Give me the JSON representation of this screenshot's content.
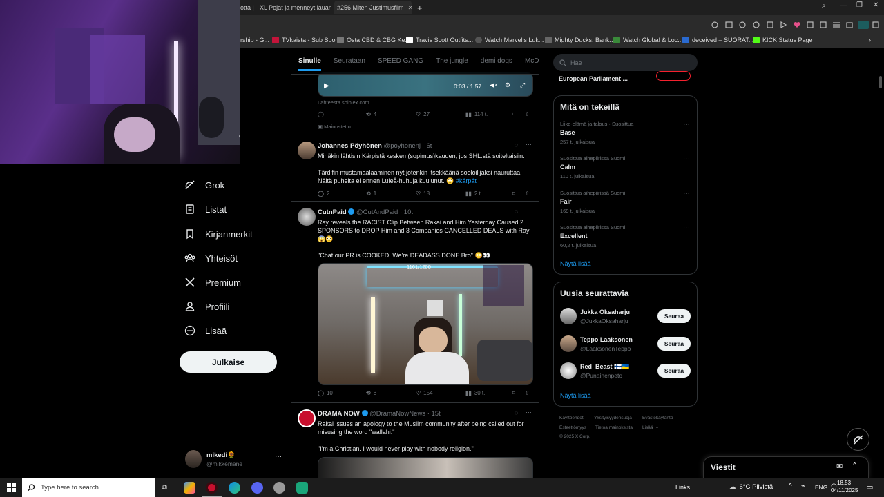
{
  "browser": {
    "tabs": [
      {
        "label": "otta |"
      },
      {
        "label": "XL Pojat ja menneyt lauant"
      },
      {
        "label": "#256 Miten Justimusfilm"
      }
    ],
    "new_tab": "+",
    "bookmarks": [
      {
        "label": "rship - G..."
      },
      {
        "label": "TVkaista - Sub Suora"
      },
      {
        "label": "Osta CBD & CBG Ke..."
      },
      {
        "label": "Travis Scott Outfits..."
      },
      {
        "label": "Watch Marvel's Luk..."
      },
      {
        "label": "Mighty Ducks: Bank..."
      },
      {
        "label": "Watch Global & Loc..."
      },
      {
        "label": "deceived – SUORAT..."
      },
      {
        "label": "KICK Status Page"
      }
    ]
  },
  "webcam": {
    "partial_text": "et"
  },
  "sidebar": {
    "items": [
      {
        "label": "Grok",
        "icon": "grok-icon"
      },
      {
        "label": "Listat",
        "icon": "list-icon"
      },
      {
        "label": "Kirjanmerkit",
        "icon": "bookmark-icon"
      },
      {
        "label": "Yhteisöt",
        "icon": "communities-icon"
      },
      {
        "label": "Premium",
        "icon": "x-logo-icon"
      },
      {
        "label": "Profiili",
        "icon": "profile-icon"
      },
      {
        "label": "Lisää",
        "icon": "more-circle-icon"
      }
    ],
    "post_button": "Julkaise",
    "account": {
      "name": "mikedi🌻",
      "handle": "@mikkemane",
      "more": "···"
    }
  },
  "feed": {
    "tabs": [
      {
        "label": "Sinulle",
        "active": true
      },
      {
        "label": "Seurataan"
      },
      {
        "label": "SPEED GANG"
      },
      {
        "label": "The jungle"
      },
      {
        "label": "demi dogs"
      },
      {
        "label": "McDonal"
      }
    ],
    "ad": {
      "video_time": "0:03 / 1:57",
      "source": "Lähteestä solplex.com",
      "retweets": "4",
      "likes": "27",
      "views": "114 t.",
      "promoted": "Mainostettu"
    },
    "tweets": [
      {
        "name": "Johannes Pöyhönen",
        "handle": "@poyhonenj",
        "time": "· 6t",
        "text1": "Minäkin lähtisin Kärpistä kesken (sopimus)kauden, jos SHL:stä soiteltaisiin.",
        "text2": "Tärdifin mustamaalaaminen nyt jotenkin itsekkäänä sooloilijaksi nauruttaa. Näitä puheita ei ennen Luleå-huhuja kuulunut. 🙄",
        "hashtag": "#kärpät",
        "replies": "2",
        "retweets": "1",
        "likes": "18",
        "views": "2 t."
      },
      {
        "name": "CutnPaid",
        "handle": "@CutAndPaid",
        "time": "· 10t",
        "text1": "Ray reveals the RACIST Clip Between Rakai and Him Yesterday Caused 2 SPONSORS to DROP Him and 3 Companies CANCELLED DEALS with Ray 😱😳",
        "text2": "\"Chat our PR is COOKED. We're DEADASS DONE Bro\" 😳👀",
        "media_counter": "1161/1200",
        "replies": "10",
        "retweets": "8",
        "likes": "154",
        "views": "30 t."
      },
      {
        "name": "DRAMA NOW",
        "handle": "@DramaNowNews",
        "time": "· 15t",
        "text1": "Rakai issues an apology to the Muslim community after being called out for misusing the word \"wallahi.\"",
        "text2": "\"I'm a Christian. I would never play with nobody religion.\""
      }
    ]
  },
  "right": {
    "search_placeholder": "Hae",
    "top_partial": "European Parliament ...",
    "trends_title": "Mitä on tekeillä",
    "trends": [
      {
        "sub": "Liike-elämä ja talous · Suosittua",
        "name": "Base",
        "count": "257 t. julkaisua"
      },
      {
        "sub": "Suosittua aihepiirissä Suomi",
        "name": "Calm",
        "count": "110 t. julkaisua"
      },
      {
        "sub": "Suosittua aihepiirissä Suomi",
        "name": "Fair",
        "count": "169 t. julkaisua"
      },
      {
        "sub": "Suosittua aihepiirissä Suomi",
        "name": "Excellent",
        "count": "60,2 t. julkaisua"
      }
    ],
    "show_more": "Näytä lisää",
    "follow_title": "Uusia seurattavia",
    "follow": [
      {
        "name": "Jukka Oksaharju",
        "handle": "@JukkaOksaharju",
        "button": "Seuraa"
      },
      {
        "name": "Teppo Laaksonen",
        "handle": "@LaaksonenTeppo",
        "button": "Seuraa"
      },
      {
        "name": "Red_Beast 🇫🇮🇺🇦",
        "handle": "@Punainenpeto",
        "button": "Seuraa"
      }
    ],
    "footer": [
      "Käyttöehdot",
      "Yksityisyydensuoja",
      "Evästekäytäntö",
      "Esteettömyys",
      "Tietoa mainoksista",
      "Lisää ···",
      "© 2025 X Corp."
    ],
    "messages": "Viestit"
  },
  "taskbar": {
    "search_placeholder": "Type here to search",
    "links": "Links",
    "weather": "6°C Pilvistä",
    "lang": "ENG",
    "time": "18.53",
    "date": "04/11/2025"
  },
  "colors": {
    "accent": "#1d9bf0",
    "background": "#000000",
    "border": "#2f3336"
  }
}
